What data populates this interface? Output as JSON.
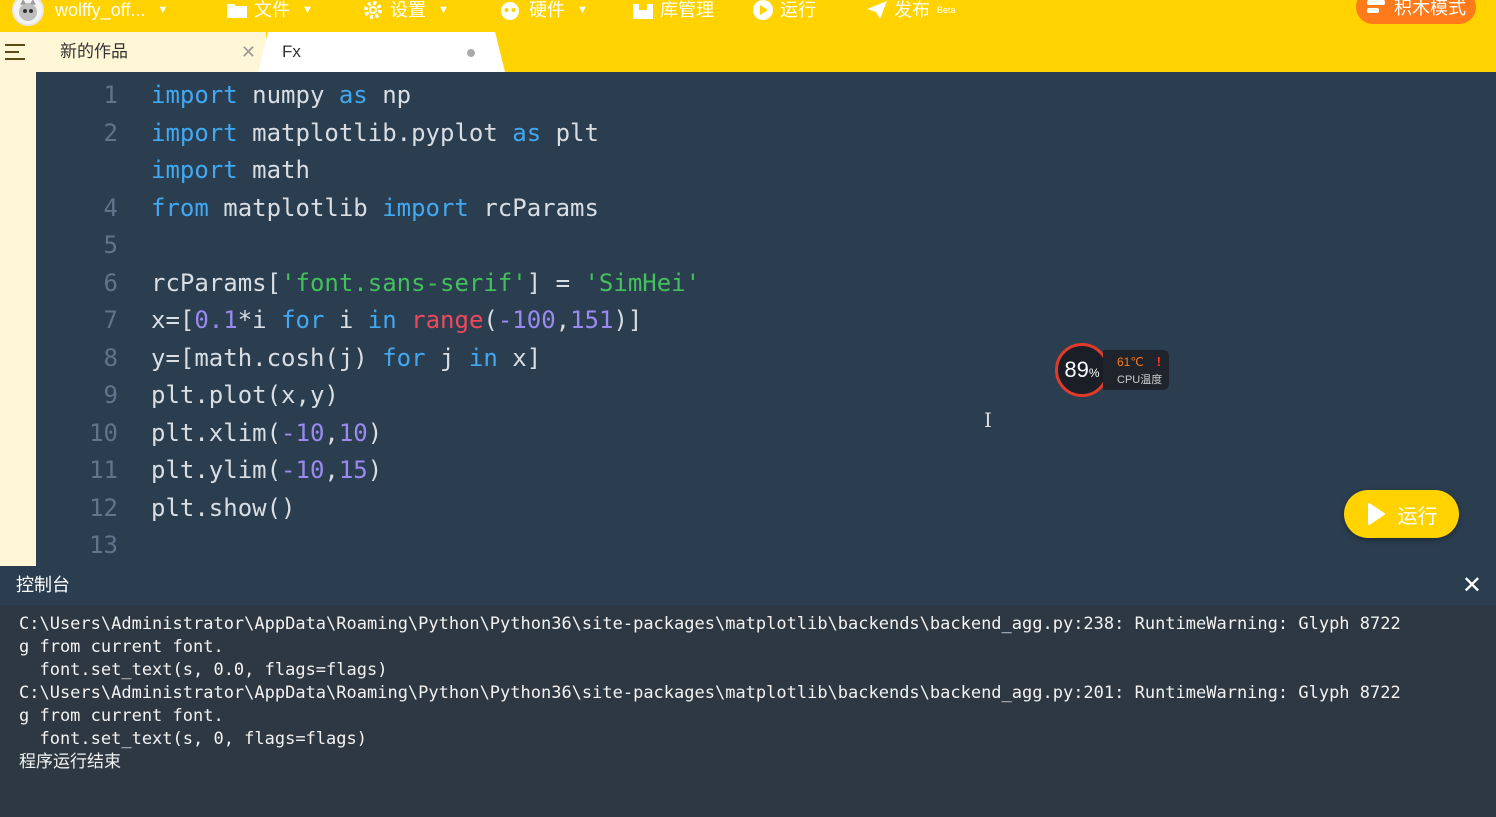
{
  "menubar": {
    "user_name": "wolffy_off...",
    "file_label": "文件",
    "settings_label": "设置",
    "hardware_label": "硬件",
    "library_label": "库管理",
    "run_label": "运行",
    "publish_label": "发布",
    "publish_badge": "Beta",
    "mode_button_label": "积木模式"
  },
  "tabs": [
    {
      "label": "新的作品"
    },
    {
      "label": "Fx"
    }
  ],
  "editor": {
    "line_numbers": [
      "1",
      "2",
      "",
      "4",
      "5",
      "6",
      "7",
      "8",
      "9",
      "10",
      "11",
      "12",
      "13"
    ],
    "lines": [
      [
        [
          "import",
          "kw"
        ],
        [
          " numpy ",
          "op"
        ],
        [
          "as",
          "kw"
        ],
        [
          " np",
          "op"
        ]
      ],
      [
        [
          "import",
          "kw"
        ],
        [
          " matplotlib.pyplot ",
          "op"
        ],
        [
          "as",
          "kw"
        ],
        [
          " plt",
          "op"
        ]
      ],
      [
        [
          "import",
          "kw"
        ],
        [
          " math",
          "op"
        ]
      ],
      [
        [
          "from",
          "kw"
        ],
        [
          " matplotlib ",
          "op"
        ],
        [
          "import",
          "kw"
        ],
        [
          " rcParams",
          "op"
        ]
      ],
      [],
      [
        [
          "rcParams[",
          "op"
        ],
        [
          "'font.sans-serif'",
          "str"
        ],
        [
          "] = ",
          "op"
        ],
        [
          "'SimHei'",
          "str"
        ]
      ],
      [
        [
          "x=[",
          "op"
        ],
        [
          "0.1",
          "num"
        ],
        [
          "*i ",
          "op"
        ],
        [
          "for",
          "kw"
        ],
        [
          " i ",
          "op"
        ],
        [
          "in",
          "kw"
        ],
        [
          " ",
          "op"
        ],
        [
          "range",
          "fn"
        ],
        [
          "(",
          "op"
        ],
        [
          "-100",
          "num"
        ],
        [
          ",",
          "op"
        ],
        [
          "151",
          "num"
        ],
        [
          ")]",
          "op"
        ]
      ],
      [
        [
          "y=[math.cosh(j) ",
          "op"
        ],
        [
          "for",
          "kw"
        ],
        [
          " j ",
          "op"
        ],
        [
          "in",
          "kw"
        ],
        [
          " x]",
          "op"
        ]
      ],
      [
        [
          "plt.plot(x,y)",
          "op"
        ]
      ],
      [
        [
          "plt.xlim(",
          "op"
        ],
        [
          "-10",
          "num"
        ],
        [
          ",",
          "op"
        ],
        [
          "10",
          "num"
        ],
        [
          ")",
          "op"
        ]
      ],
      [
        [
          "plt.ylim(",
          "op"
        ],
        [
          "-10",
          "num"
        ],
        [
          ",",
          "op"
        ],
        [
          "15",
          "num"
        ],
        [
          ")",
          "op"
        ]
      ],
      [
        [
          "plt.show()",
          "op"
        ]
      ],
      []
    ]
  },
  "cpu_widget": {
    "usage_value": "89",
    "usage_unit": "%",
    "temperature": "61℃",
    "label": "CPU温度",
    "warning": "!"
  },
  "run_button": {
    "label": "运行"
  },
  "console": {
    "title": "控制台",
    "close_glyph": "✕",
    "lines": [
      "C:\\Users\\Administrator\\AppData\\Roaming\\Python\\Python36\\site-packages\\matplotlib\\backends\\backend_agg.py:238: RuntimeWarning: Glyph 8722",
      "g from current font.",
      "  font.set_text(s, 0.0, flags=flags)",
      "C:\\Users\\Administrator\\AppData\\Roaming\\Python\\Python36\\site-packages\\matplotlib\\backends\\backend_agg.py:201: RuntimeWarning: Glyph 8722",
      "g from current font.",
      "  font.set_text(s, 0, flags=flags)",
      "程序运行结束"
    ]
  },
  "colors": {
    "accent_yellow": "#FFD200",
    "editor_bg": "#2B3E50",
    "console_bg": "#2E3843",
    "keyword": "#41A8F2",
    "string": "#43C05C",
    "number": "#9A8AF0",
    "builtin": "#F0485B"
  }
}
